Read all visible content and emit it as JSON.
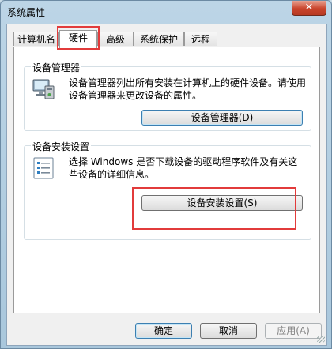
{
  "window": {
    "title": "系统属性",
    "close_glyph": "✕"
  },
  "tabs": [
    {
      "label": "计算机名"
    },
    {
      "label": "硬件"
    },
    {
      "label": "高级"
    },
    {
      "label": "系统保护"
    },
    {
      "label": "远程"
    }
  ],
  "active_tab": "硬件",
  "device_manager": {
    "title": "设备管理器",
    "description": "设备管理器列出所有安装在计算机上的硬件设备。请使用设备管理器来更改设备的属性。",
    "button_label": "设备管理器(D)",
    "icon": "device-manager-icon"
  },
  "device_install": {
    "title": "设备安装设置",
    "description": "选择 Windows 是否下载设备的驱动程序软件及有关这些设备的详细信息。",
    "button_label": "设备安装设置(S)",
    "icon": "checklist-icon"
  },
  "footer": {
    "ok_label": "确定",
    "cancel_label": "取消",
    "apply_label": "应用(A)"
  },
  "colors": {
    "highlight_red": "#e23b3b",
    "title_bar": "#bcd5e6",
    "close_red": "#c9442c"
  }
}
